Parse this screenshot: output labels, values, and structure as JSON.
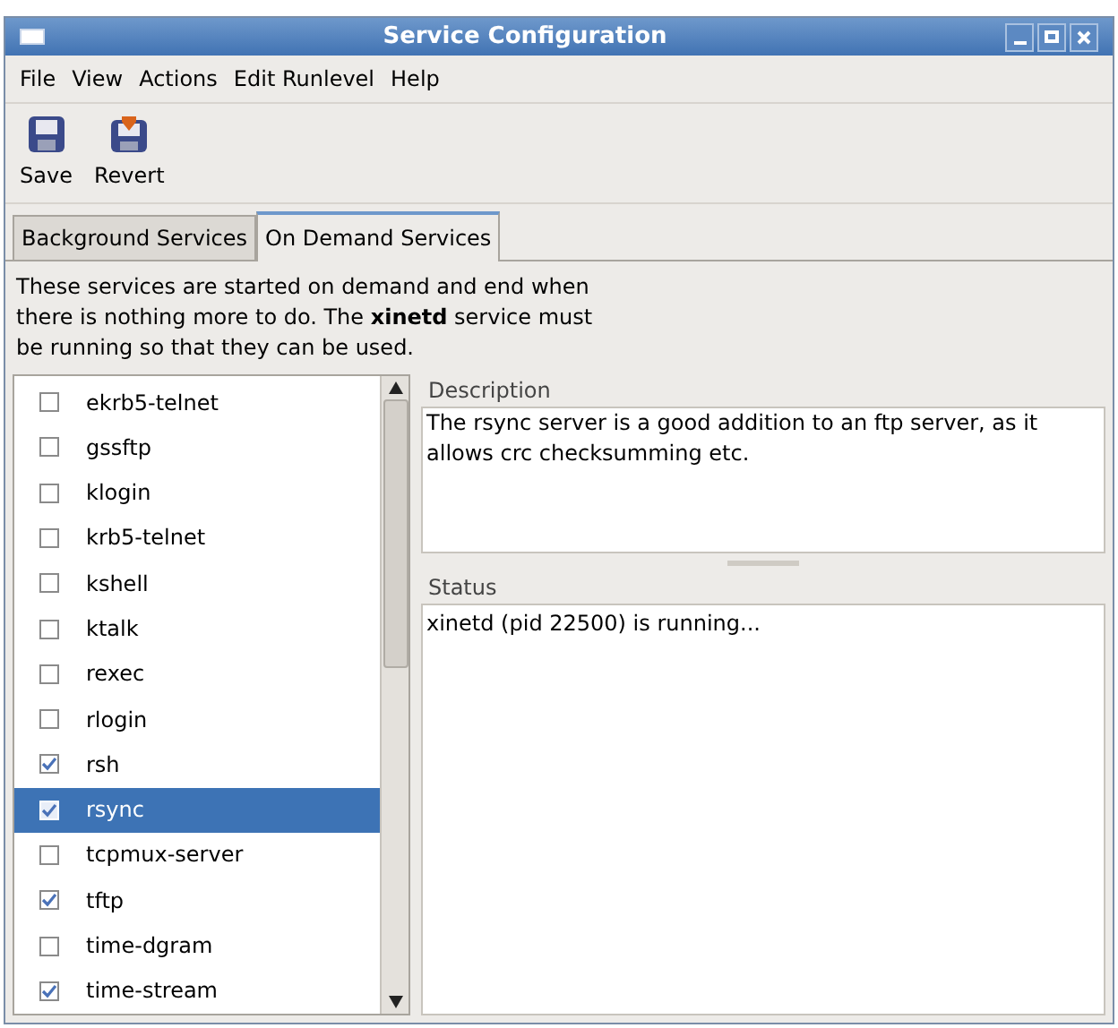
{
  "window": {
    "title": "Service Configuration"
  },
  "menu": [
    "File",
    "View",
    "Actions",
    "Edit Runlevel",
    "Help"
  ],
  "toolbar": [
    {
      "label": "Save",
      "kind": "save"
    },
    {
      "label": "Revert",
      "kind": "revert"
    }
  ],
  "tabs": [
    {
      "label": "Background Services",
      "selected": false
    },
    {
      "label": "On Demand Services",
      "selected": true
    }
  ],
  "intro": "These services are started on demand and end when there is nothing more to do. The **xinetd** service must be running so that they can be used.",
  "services": [
    {
      "name": "ekrb5-telnet",
      "checked": false,
      "selected": false
    },
    {
      "name": "gssftp",
      "checked": false,
      "selected": false
    },
    {
      "name": "klogin",
      "checked": false,
      "selected": false
    },
    {
      "name": "krb5-telnet",
      "checked": false,
      "selected": false
    },
    {
      "name": "kshell",
      "checked": false,
      "selected": false
    },
    {
      "name": "ktalk",
      "checked": false,
      "selected": false
    },
    {
      "name": "rexec",
      "checked": false,
      "selected": false
    },
    {
      "name": "rlogin",
      "checked": false,
      "selected": false
    },
    {
      "name": "rsh",
      "checked": true,
      "selected": false
    },
    {
      "name": "rsync",
      "checked": true,
      "selected": true
    },
    {
      "name": "tcpmux-server",
      "checked": false,
      "selected": false
    },
    {
      "name": "tftp",
      "checked": true,
      "selected": false
    },
    {
      "name": "time-dgram",
      "checked": false,
      "selected": false
    },
    {
      "name": "time-stream",
      "checked": true,
      "selected": false
    }
  ],
  "description": {
    "label": "Description",
    "text": "The rsync server is a good addition to an ftp server, as it allows crc checksumming etc."
  },
  "status": {
    "label": "Status",
    "text": "xinetd (pid 22500) is running..."
  }
}
